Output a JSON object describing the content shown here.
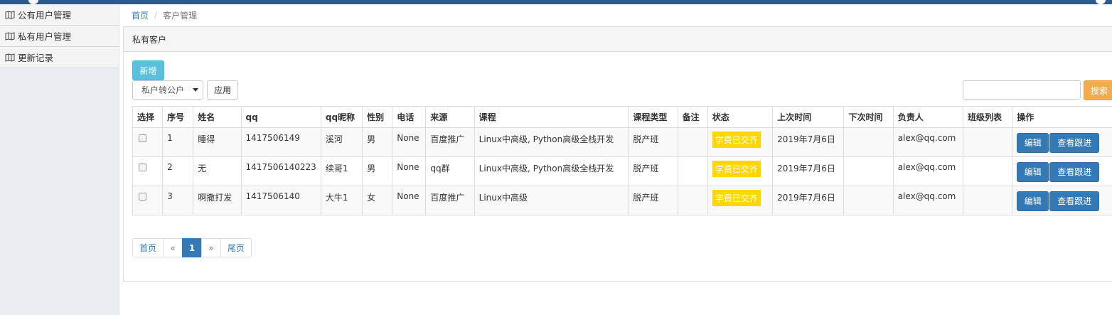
{
  "sidebar": {
    "items": [
      {
        "label": "公有用户管理",
        "icon": "map-icon"
      },
      {
        "label": "私有用户管理",
        "icon": "map-icon"
      },
      {
        "label": "更新记录",
        "icon": "map-icon"
      }
    ]
  },
  "breadcrumb": {
    "home": "首页",
    "separator": "/",
    "current": "客户管理"
  },
  "panel": {
    "title": "私有客户"
  },
  "toolbar": {
    "add_label": "新增",
    "action_select": "私户转公户",
    "apply_label": "应用",
    "search_placeholder": "",
    "search_label": "搜索"
  },
  "table": {
    "headers": [
      "选择",
      "序号",
      "姓名",
      "qq",
      "qq昵称",
      "性别",
      "电话",
      "来源",
      "课程",
      "课程类型",
      "备注",
      "状态",
      "上次时间",
      "下次时间",
      "负责人",
      "班级列表",
      "操作"
    ],
    "rows": [
      {
        "index": "1",
        "name": "睡得",
        "qq": "1417506149",
        "nick": "溪河",
        "gender": "男",
        "phone": "None",
        "source": "百度推广",
        "course": "Linux中高级, Python高级全栈开发",
        "course_type": "脱产班",
        "note": "",
        "status": "学费已交齐",
        "last": "2019年7月6日",
        "next": "",
        "owner": "alex@qq.com",
        "classes": "",
        "edit": "编辑",
        "follow": "查看跟进"
      },
      {
        "index": "2",
        "name": "无",
        "qq": "1417506140223",
        "nick": "续哥1",
        "gender": "男",
        "phone": "None",
        "source": "qq群",
        "course": "Linux中高级, Python高级全栈开发",
        "course_type": "脱产班",
        "note": "",
        "status": "学费已交齐",
        "last": "2019年7月6日",
        "next": "",
        "owner": "alex@qq.com",
        "classes": "",
        "edit": "编辑",
        "follow": "查看跟进"
      },
      {
        "index": "3",
        "name": "啊撒打发",
        "qq": "1417506140",
        "nick": "大牛1",
        "gender": "女",
        "phone": "None",
        "source": "百度推广",
        "course": "Linux中高级",
        "course_type": "脱产班",
        "note": "",
        "status": "学费已交齐",
        "last": "2019年7月6日",
        "next": "",
        "owner": "alex@qq.com",
        "classes": "",
        "edit": "编辑",
        "follow": "查看跟进"
      }
    ]
  },
  "pagination": {
    "first": "首页",
    "prev": "«",
    "current": "1",
    "next": "»",
    "last": "尾页"
  },
  "colors": {
    "primary": "#337ab7",
    "info": "#5bc0de",
    "warning": "#f0ad4e",
    "status_badge": "#ffd700",
    "topbar": "#2f5a8e"
  }
}
